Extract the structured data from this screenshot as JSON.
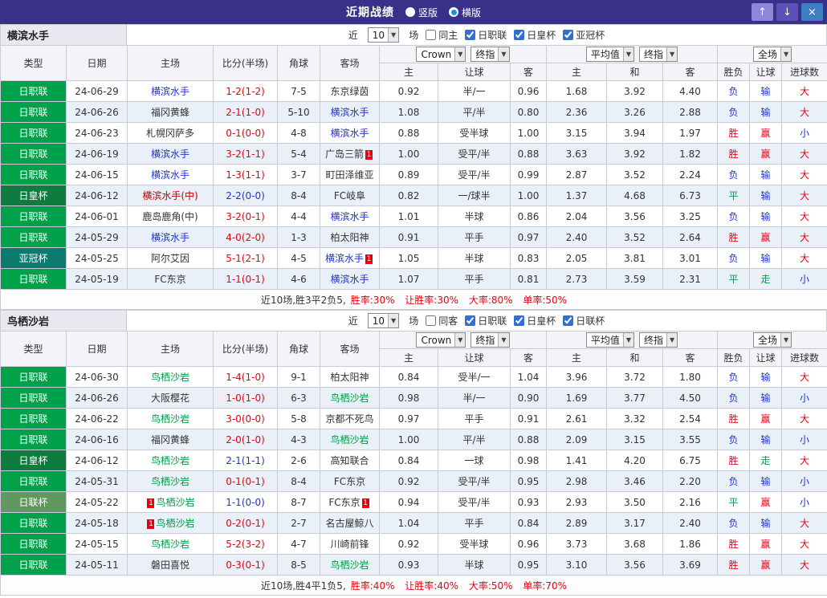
{
  "titlebar": {
    "title": "近期战绩",
    "layout_options": [
      {
        "label": "竖版",
        "selected": false
      },
      {
        "label": "横版",
        "selected": true
      }
    ],
    "buttons": {
      "up": "↑",
      "down": "↓",
      "close": "×"
    }
  },
  "colors": {
    "titlebar_bg": "#393189",
    "league_colors": {
      "日职联": "#00A14B",
      "日皇杯": "#0F7C3F",
      "亚冠杯": "#0D7A70",
      "日联杯": "#61985F"
    },
    "team_colors": {
      "blue": "#2233CC",
      "green": "#009B47",
      "red": "#C00000",
      "black": "#333333"
    },
    "score_colors": {
      "red": "#E60012",
      "blue": "#2233CC"
    },
    "result_colors": {
      "胜": "#E60012",
      "负": "#2233CC",
      "平": "#00A14B",
      "赢": "#E60012",
      "输": "#2233CC",
      "走": "#00A14B",
      "大": "#E60012",
      "小": "#2233CC"
    }
  },
  "table_header": {
    "static_cols": [
      "类型",
      "日期",
      "主场",
      "比分(半场)",
      "角球",
      "客场"
    ],
    "bookmaker_select": "Crown",
    "bookmaker_stage_select": "终指",
    "bookmaker_cols": [
      "主",
      "让球",
      "客"
    ],
    "average_select": "平均值",
    "average_stage_select": "终指",
    "average_cols": [
      "主",
      "和",
      "客"
    ],
    "scope_select": "全场",
    "result_cols": [
      "胜负",
      "让球",
      "进球数"
    ]
  },
  "sections": [
    {
      "team": "横滨水手",
      "filters": {
        "near_label": "近",
        "count": "10",
        "unit_label": "场",
        "same_venue": {
          "label": "同主",
          "checked": false
        },
        "leagues": [
          {
            "label": "日职联",
            "checked": true
          },
          {
            "label": "日皇杯",
            "checked": true
          },
          {
            "label": "亚冠杯",
            "checked": true
          }
        ]
      },
      "rows": [
        {
          "league": "日职联",
          "date": "24-06-29",
          "home": {
            "name": "横滨水手",
            "color": "blue"
          },
          "score": {
            "text": "1-2(1-2)",
            "color": "red"
          },
          "corner": "7-5",
          "away": {
            "name": "东京绿茵",
            "color": "black"
          },
          "bk": [
            "0.92",
            "半/一",
            "0.96"
          ],
          "avg": [
            "1.68",
            "3.92",
            "4.40"
          ],
          "results": [
            "负",
            "输",
            "大"
          ]
        },
        {
          "league": "日职联",
          "date": "24-06-26",
          "home": {
            "name": "福冈黄蜂",
            "color": "black"
          },
          "score": {
            "text": "2-1(1-0)",
            "color": "red"
          },
          "corner": "5-10",
          "away": {
            "name": "横滨水手",
            "color": "blue"
          },
          "bk": [
            "1.08",
            "平/半",
            "0.80"
          ],
          "avg": [
            "2.36",
            "3.26",
            "2.88"
          ],
          "results": [
            "负",
            "输",
            "大"
          ]
        },
        {
          "league": "日职联",
          "date": "24-06-23",
          "home": {
            "name": "札幌冈萨多",
            "color": "black"
          },
          "score": {
            "text": "0-1(0-0)",
            "color": "red"
          },
          "corner": "4-8",
          "away": {
            "name": "横滨水手",
            "color": "blue"
          },
          "bk": [
            "0.88",
            "受半球",
            "1.00"
          ],
          "avg": [
            "3.15",
            "3.94",
            "1.97"
          ],
          "results": [
            "胜",
            "赢",
            "小"
          ]
        },
        {
          "league": "日职联",
          "date": "24-06-19",
          "home": {
            "name": "横滨水手",
            "color": "blue"
          },
          "score": {
            "text": "3-2(1-1)",
            "color": "red"
          },
          "corner": "5-4",
          "away": {
            "name": "广岛三箭",
            "color": "black",
            "card_after": "1"
          },
          "bk": [
            "1.00",
            "受平/半",
            "0.88"
          ],
          "avg": [
            "3.63",
            "3.92",
            "1.82"
          ],
          "results": [
            "胜",
            "赢",
            "大"
          ]
        },
        {
          "league": "日职联",
          "date": "24-06-15",
          "home": {
            "name": "横滨水手",
            "color": "blue"
          },
          "score": {
            "text": "1-3(1-1)",
            "color": "red"
          },
          "corner": "3-7",
          "away": {
            "name": "町田泽维亚",
            "color": "black"
          },
          "bk": [
            "0.89",
            "受平/半",
            "0.99"
          ],
          "avg": [
            "2.87",
            "3.52",
            "2.24"
          ],
          "results": [
            "负",
            "输",
            "大"
          ]
        },
        {
          "league": "日皇杯",
          "date": "24-06-12",
          "home": {
            "name": "横滨水手(中)",
            "color": "red"
          },
          "score": {
            "text": "2-2(0-0)",
            "color": "blue"
          },
          "corner": "8-4",
          "away": {
            "name": "FC岐阜",
            "color": "black"
          },
          "bk": [
            "0.82",
            "一/球半",
            "1.00"
          ],
          "avg": [
            "1.37",
            "4.68",
            "6.73"
          ],
          "results": [
            "平",
            "输",
            "大"
          ]
        },
        {
          "league": "日职联",
          "date": "24-06-01",
          "home": {
            "name": "鹿岛鹿角(中)",
            "color": "black"
          },
          "score": {
            "text": "3-2(0-1)",
            "color": "red"
          },
          "corner": "4-4",
          "away": {
            "name": "横滨水手",
            "color": "blue"
          },
          "bk": [
            "1.01",
            "半球",
            "0.86"
          ],
          "avg": [
            "2.04",
            "3.56",
            "3.25"
          ],
          "results": [
            "负",
            "输",
            "大"
          ]
        },
        {
          "league": "日职联",
          "date": "24-05-29",
          "home": {
            "name": "横滨水手",
            "color": "blue"
          },
          "score": {
            "text": "4-0(2-0)",
            "color": "red"
          },
          "corner": "1-3",
          "away": {
            "name": "柏太阳神",
            "color": "black"
          },
          "bk": [
            "0.91",
            "平手",
            "0.97"
          ],
          "avg": [
            "2.40",
            "3.52",
            "2.64"
          ],
          "results": [
            "胜",
            "赢",
            "大"
          ]
        },
        {
          "league": "亚冠杯",
          "date": "24-05-25",
          "home": {
            "name": "阿尔艾因",
            "color": "black"
          },
          "score": {
            "text": "5-1(2-1)",
            "color": "red"
          },
          "corner": "4-5",
          "away": {
            "name": "横滨水手",
            "color": "blue",
            "card_after": "1"
          },
          "bk": [
            "1.05",
            "半球",
            "0.83"
          ],
          "avg": [
            "2.05",
            "3.81",
            "3.01"
          ],
          "results": [
            "负",
            "输",
            "大"
          ]
        },
        {
          "league": "日职联",
          "date": "24-05-19",
          "home": {
            "name": "FC东京",
            "color": "black"
          },
          "score": {
            "text": "1-1(0-1)",
            "color": "red"
          },
          "corner": "4-6",
          "away": {
            "name": "横滨水手",
            "color": "blue"
          },
          "bk": [
            "1.07",
            "平手",
            "0.81"
          ],
          "avg": [
            "2.73",
            "3.59",
            "2.31"
          ],
          "results": [
            "平",
            "走",
            "小"
          ]
        }
      ],
      "summary": {
        "prefix": "近10场,胜3平2负5,",
        "stats": "胜率:30% 让胜率:30% 大率:80% 单率:50%"
      }
    },
    {
      "team": "鸟栖沙岩",
      "filters": {
        "near_label": "近",
        "count": "10",
        "unit_label": "场",
        "same_venue": {
          "label": "同客",
          "checked": false
        },
        "leagues": [
          {
            "label": "日职联",
            "checked": true
          },
          {
            "label": "日皇杯",
            "checked": true
          },
          {
            "label": "日联杯",
            "checked": true
          }
        ]
      },
      "rows": [
        {
          "league": "日职联",
          "date": "24-06-30",
          "home": {
            "name": "鸟栖沙岩",
            "color": "green"
          },
          "score": {
            "text": "1-4(1-0)",
            "color": "red"
          },
          "corner": "9-1",
          "away": {
            "name": "柏太阳神",
            "color": "black"
          },
          "bk": [
            "0.84",
            "受半/一",
            "1.04"
          ],
          "avg": [
            "3.96",
            "3.72",
            "1.80"
          ],
          "results": [
            "负",
            "输",
            "大"
          ]
        },
        {
          "league": "日职联",
          "date": "24-06-26",
          "home": {
            "name": "大阪樱花",
            "color": "black"
          },
          "score": {
            "text": "1-0(1-0)",
            "color": "red"
          },
          "corner": "6-3",
          "away": {
            "name": "鸟栖沙岩",
            "color": "green"
          },
          "bk": [
            "0.98",
            "半/一",
            "0.90"
          ],
          "avg": [
            "1.69",
            "3.77",
            "4.50"
          ],
          "results": [
            "负",
            "输",
            "小"
          ]
        },
        {
          "league": "日职联",
          "date": "24-06-22",
          "home": {
            "name": "鸟栖沙岩",
            "color": "green"
          },
          "score": {
            "text": "3-0(0-0)",
            "color": "red"
          },
          "corner": "5-8",
          "away": {
            "name": "京都不死鸟",
            "color": "black"
          },
          "bk": [
            "0.97",
            "平手",
            "0.91"
          ],
          "avg": [
            "2.61",
            "3.32",
            "2.54"
          ],
          "results": [
            "胜",
            "赢",
            "大"
          ]
        },
        {
          "league": "日职联",
          "date": "24-06-16",
          "home": {
            "name": "福冈黄蜂",
            "color": "black"
          },
          "score": {
            "text": "2-0(1-0)",
            "color": "red"
          },
          "corner": "4-3",
          "away": {
            "name": "鸟栖沙岩",
            "color": "green"
          },
          "bk": [
            "1.00",
            "平/半",
            "0.88"
          ],
          "avg": [
            "2.09",
            "3.15",
            "3.55"
          ],
          "results": [
            "负",
            "输",
            "小"
          ]
        },
        {
          "league": "日皇杯",
          "date": "24-06-12",
          "home": {
            "name": "鸟栖沙岩",
            "color": "green"
          },
          "score": {
            "text": "2-1(1-1)",
            "color": "blue"
          },
          "corner": "2-6",
          "away": {
            "name": "高知联合",
            "color": "black"
          },
          "bk": [
            "0.84",
            "一球",
            "0.98"
          ],
          "avg": [
            "1.41",
            "4.20",
            "6.75"
          ],
          "results": [
            "胜",
            "走",
            "大"
          ]
        },
        {
          "league": "日职联",
          "date": "24-05-31",
          "home": {
            "name": "鸟栖沙岩",
            "color": "green"
          },
          "score": {
            "text": "0-1(0-1)",
            "color": "red"
          },
          "corner": "8-4",
          "away": {
            "name": "FC东京",
            "color": "black"
          },
          "bk": [
            "0.92",
            "受平/半",
            "0.95"
          ],
          "avg": [
            "2.98",
            "3.46",
            "2.20"
          ],
          "results": [
            "负",
            "输",
            "小"
          ]
        },
        {
          "league": "日联杯",
          "date": "24-05-22",
          "home": {
            "name": "鸟栖沙岩",
            "color": "green",
            "card_before": "1"
          },
          "score": {
            "text": "1-1(0-0)",
            "color": "blue"
          },
          "corner": "8-7",
          "away": {
            "name": "FC东京",
            "color": "black",
            "card_after": "1"
          },
          "bk": [
            "0.94",
            "受平/半",
            "0.93"
          ],
          "avg": [
            "2.93",
            "3.50",
            "2.16"
          ],
          "results": [
            "平",
            "赢",
            "小"
          ]
        },
        {
          "league": "日职联",
          "date": "24-05-18",
          "home": {
            "name": "鸟栖沙岩",
            "color": "green",
            "card_before": "1"
          },
          "score": {
            "text": "0-2(0-1)",
            "color": "red"
          },
          "corner": "2-7",
          "away": {
            "name": "名古屋鲸八",
            "color": "black"
          },
          "bk": [
            "1.04",
            "平手",
            "0.84"
          ],
          "avg": [
            "2.89",
            "3.17",
            "2.40"
          ],
          "results": [
            "负",
            "输",
            "大"
          ]
        },
        {
          "league": "日职联",
          "date": "24-05-15",
          "home": {
            "name": "鸟栖沙岩",
            "color": "green"
          },
          "score": {
            "text": "5-2(3-2)",
            "color": "red"
          },
          "corner": "4-7",
          "away": {
            "name": "川崎前锋",
            "color": "black"
          },
          "bk": [
            "0.92",
            "受半球",
            "0.96"
          ],
          "avg": [
            "3.73",
            "3.68",
            "1.86"
          ],
          "results": [
            "胜",
            "赢",
            "大"
          ]
        },
        {
          "league": "日职联",
          "date": "24-05-11",
          "home": {
            "name": "磐田喜悦",
            "color": "black"
          },
          "score": {
            "text": "0-3(0-1)",
            "color": "red"
          },
          "corner": "8-5",
          "away": {
            "name": "鸟栖沙岩",
            "color": "green"
          },
          "bk": [
            "0.93",
            "半球",
            "0.95"
          ],
          "avg": [
            "3.10",
            "3.56",
            "3.69"
          ],
          "results": [
            "胜",
            "赢",
            "大"
          ]
        }
      ],
      "summary": {
        "prefix": "近10场,胜4平1负5,",
        "stats": "胜率:40% 让胜率:40% 大率:50% 单率:70%"
      }
    }
  ]
}
